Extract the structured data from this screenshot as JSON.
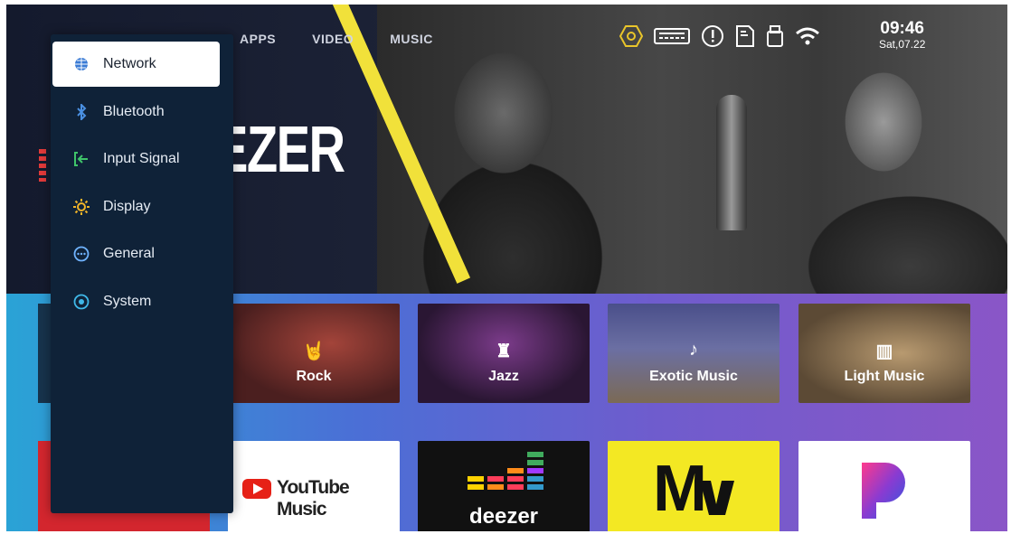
{
  "top_tabs": [
    "APPS",
    "VIDEO",
    "MUSIC"
  ],
  "status": {
    "icons": [
      "settings-hex-icon",
      "keyboard-icon",
      "alert-icon",
      "file-icon",
      "usb-icon",
      "wifi-icon"
    ],
    "time": "09:46",
    "date": "Sat,07.22"
  },
  "hero": {
    "title": "EZER"
  },
  "settings_menu": {
    "items": [
      {
        "label": "Network",
        "icon": "globe-icon",
        "selected": true
      },
      {
        "label": "Bluetooth",
        "icon": "bluetooth-icon"
      },
      {
        "label": "Input Signal",
        "icon": "input-signal-icon"
      },
      {
        "label": "Display",
        "icon": "sun-icon"
      },
      {
        "label": "General",
        "icon": "general-icon"
      },
      {
        "label": "System",
        "icon": "system-icon"
      }
    ]
  },
  "genres": [
    {
      "label": "Rock",
      "icon": "rock-hand-icon"
    },
    {
      "label": "Jazz",
      "icon": "jazz-icon"
    },
    {
      "label": "Exotic Music",
      "icon": "music-note-icon"
    },
    {
      "label": "Light Music",
      "icon": "piano-icon"
    }
  ],
  "apps": [
    {
      "name": "YouTube Music",
      "label": "YouTube Music"
    },
    {
      "name": "Deezer",
      "label": "deezer"
    },
    {
      "name": "MTV",
      "label": "M"
    },
    {
      "name": "Pandora",
      "label": "P"
    }
  ],
  "colors": {
    "sidebar_bg": "#0f2238",
    "accent_yellow": "#f1e13a",
    "status_icon": "#e9c52a",
    "youtube_red": "#e62117",
    "mtv_yellow": "#f3e823"
  }
}
